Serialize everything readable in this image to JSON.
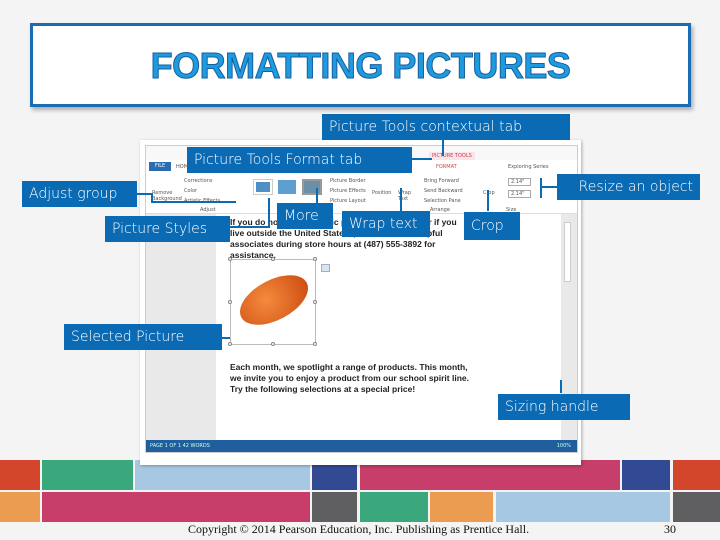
{
  "title": "FORMATTING PICTURES",
  "callouts": {
    "contextual_tab": "Picture Tools contextual tab",
    "format_tab": "Picture Tools Format tab",
    "adjust_group": "Adjust group",
    "resize": "Resize an object",
    "picture_styles": "Picture Styles",
    "more": "More",
    "wrap_text": "Wrap text",
    "crop": "Crop",
    "selected_picture": "Selected Picture",
    "sizing_handle": "Sizing handle"
  },
  "word": {
    "tabs": {
      "file": "FILE",
      "home": "HOM",
      "picture_tools": "PICTURE TOOLS",
      "format": "FORMAT"
    },
    "account": "Exploring Series",
    "ribbon": {
      "remove_bg": "Remove Background",
      "corrections": "Corrections",
      "color": "Color",
      "artistic": "Artistic Effects",
      "adjust": "Adjust",
      "border": "Picture Border",
      "effects": "Picture Effects",
      "layout": "Picture Layout",
      "position": "Position",
      "wrap": "Wrap Text",
      "bring": "Bring Forward",
      "send": "Send Backward",
      "selection": "Selection Pane",
      "arrange": "Arrange",
      "crop": "Crop",
      "height": "2.14\"",
      "width": "2.14\"",
      "size": "Size"
    },
    "para1": "If you do not see a specific product in the store or if you live outside the United States, please call our helpful associates during store hours at (487) 555-3892 for assistance.",
    "para2": "Each month, we spotlight a range of products. This month, we invite you to enjoy a product from our school spirit line. Try the following selections at a special price!",
    "status_left": "PAGE 1 OF 1   42 WORDS",
    "zoom": "100%"
  },
  "footer": {
    "copyright": "Copyright © 2014 Pearson Education, Inc. Publishing as Prentice Hall.",
    "page": "30"
  },
  "colors": {
    "callout": "#0a6ab4",
    "title": "#1d9be0"
  }
}
